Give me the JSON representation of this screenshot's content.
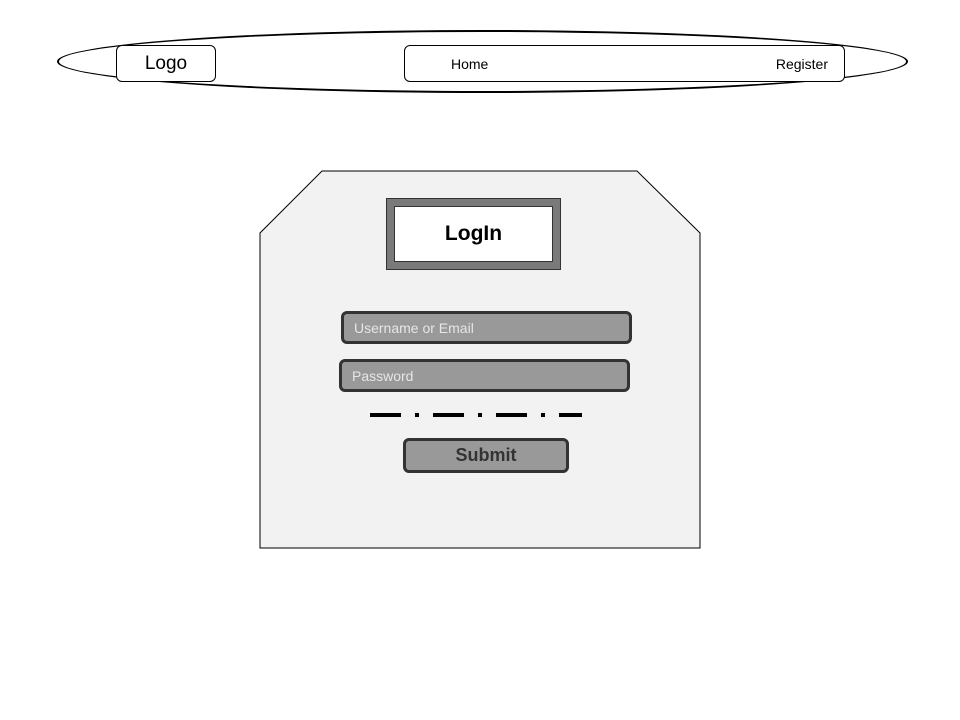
{
  "header": {
    "logo_label": "Logo",
    "nav": {
      "home_label": "Home",
      "register_label": "Register"
    }
  },
  "login_card": {
    "title": "LogIn",
    "username_field": {
      "placeholder": "Username or Email",
      "value": ""
    },
    "password_field": {
      "placeholder": "Password",
      "value": ""
    },
    "submit_label": "Submit"
  },
  "colors": {
    "card_background": "#f2f2f2",
    "field_fill": "#999999",
    "field_border": "#333333",
    "placeholder_text": "#e6e6e6",
    "title_frame": "#7a7a7a"
  }
}
